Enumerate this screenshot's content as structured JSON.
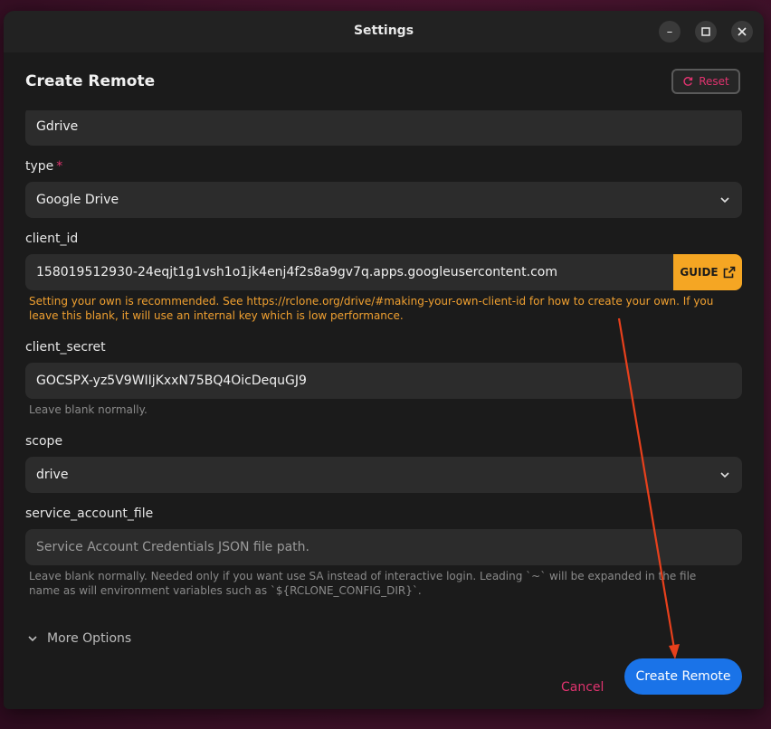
{
  "window": {
    "title": "Settings",
    "minimize_icon": "minimize-icon",
    "maximize_icon": "maximize-icon",
    "close_icon": "close-icon"
  },
  "header": {
    "title": "Create Remote",
    "reset_label": "Reset",
    "reset_icon": "refresh-icon"
  },
  "form": {
    "name_value": "Gdrive",
    "type_label": "type",
    "type_required": "*",
    "type_value": "Google Drive",
    "client_id_label": "client_id",
    "client_id_value": "158019512930-24eqjt1g1vsh1o1jk4enj4f2s8a9gv7q.apps.googleusercontent.com",
    "guide_label": "GUIDE",
    "client_id_help": "Setting your own is recommended. See https://rclone.org/drive/#making-your-own-client-id for how to create your own. If you leave this blank, it will use an internal key which is low performance.",
    "client_secret_label": "client_secret",
    "client_secret_value": "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",
    "client_secret_help": "Leave blank normally.",
    "scope_label": "scope",
    "scope_value": "drive",
    "service_account_label": "service_account_file",
    "service_account_placeholder": "Service Account Credentials JSON file path.",
    "service_account_help": "Leave blank normally. Needed only if you want use SA instead of interactive login. Leading `~` will be expanded in the file name as will environment variables such as `${RCLONE_CONFIG_DIR}`.",
    "more_options_label": "More Options"
  },
  "footer": {
    "cancel_label": "Cancel",
    "create_label": "Create Remote"
  },
  "colors": {
    "accent": "#1a73e8",
    "danger": "#e0336f",
    "warning": "#f5a623",
    "annotation_arrow": "#e8401c"
  }
}
